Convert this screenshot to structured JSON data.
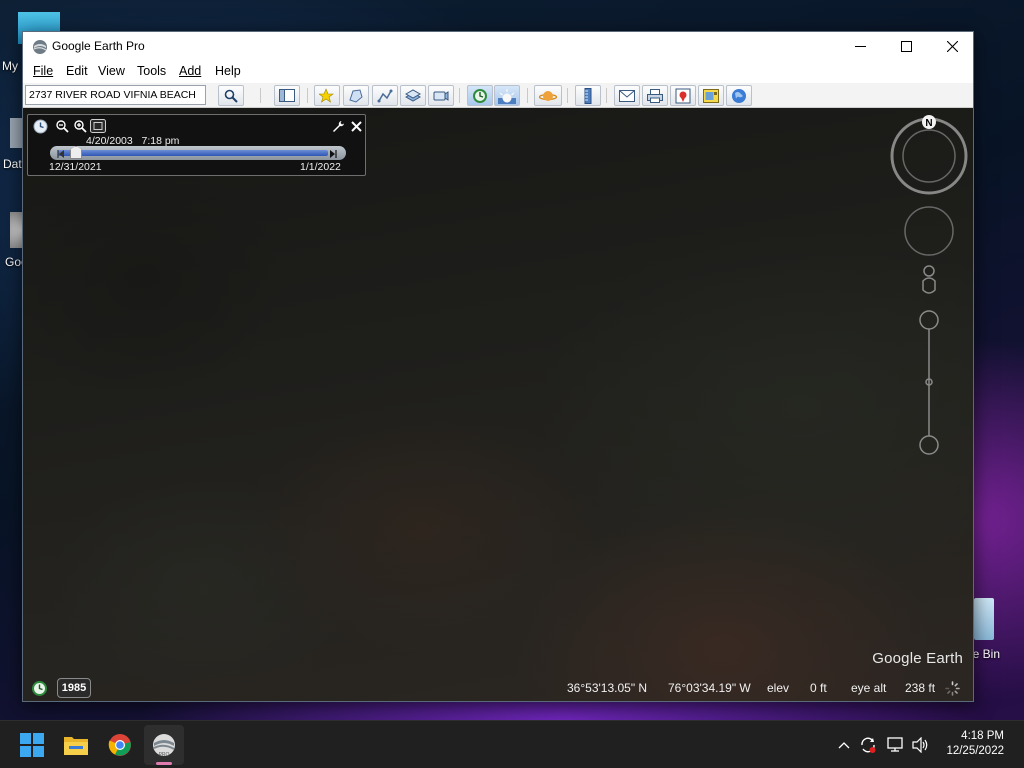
{
  "window": {
    "title": "Google Earth Pro"
  },
  "menu": [
    "File",
    "Edit",
    "View",
    "Tools",
    "Add",
    "Help"
  ],
  "search": {
    "value": "2737 RIVER ROAD VIFNIA BEACH"
  },
  "time_slider": {
    "current_date": "4/20/2003",
    "current_time": "7:18 pm",
    "start_date": "12/31/2021",
    "end_date": "1/1/2022"
  },
  "compass": {
    "north_label": "N"
  },
  "map": {
    "watermark": "Google Earth",
    "imagery_year": "1985"
  },
  "status": {
    "latitude": "36°53'13.05\" N",
    "longitude": "76°03'34.19\" W",
    "elev_label": "elev",
    "elev_value": "0 ft",
    "eye_alt_label": "eye alt",
    "eye_alt_value": "238 ft"
  },
  "desktop": {
    "icon_labels": [
      "My",
      "Data",
      "Goo",
      "cle Bin"
    ]
  },
  "taskbar": {
    "time": "4:18 PM",
    "date": "12/25/2022"
  },
  "colors": {
    "window_bg": "#ffffff",
    "toolbar_bg": "#f3f3f3",
    "panel_bg": "#111111",
    "slider_blue": "#2e56b5",
    "taskbar_bg": "#202020"
  }
}
